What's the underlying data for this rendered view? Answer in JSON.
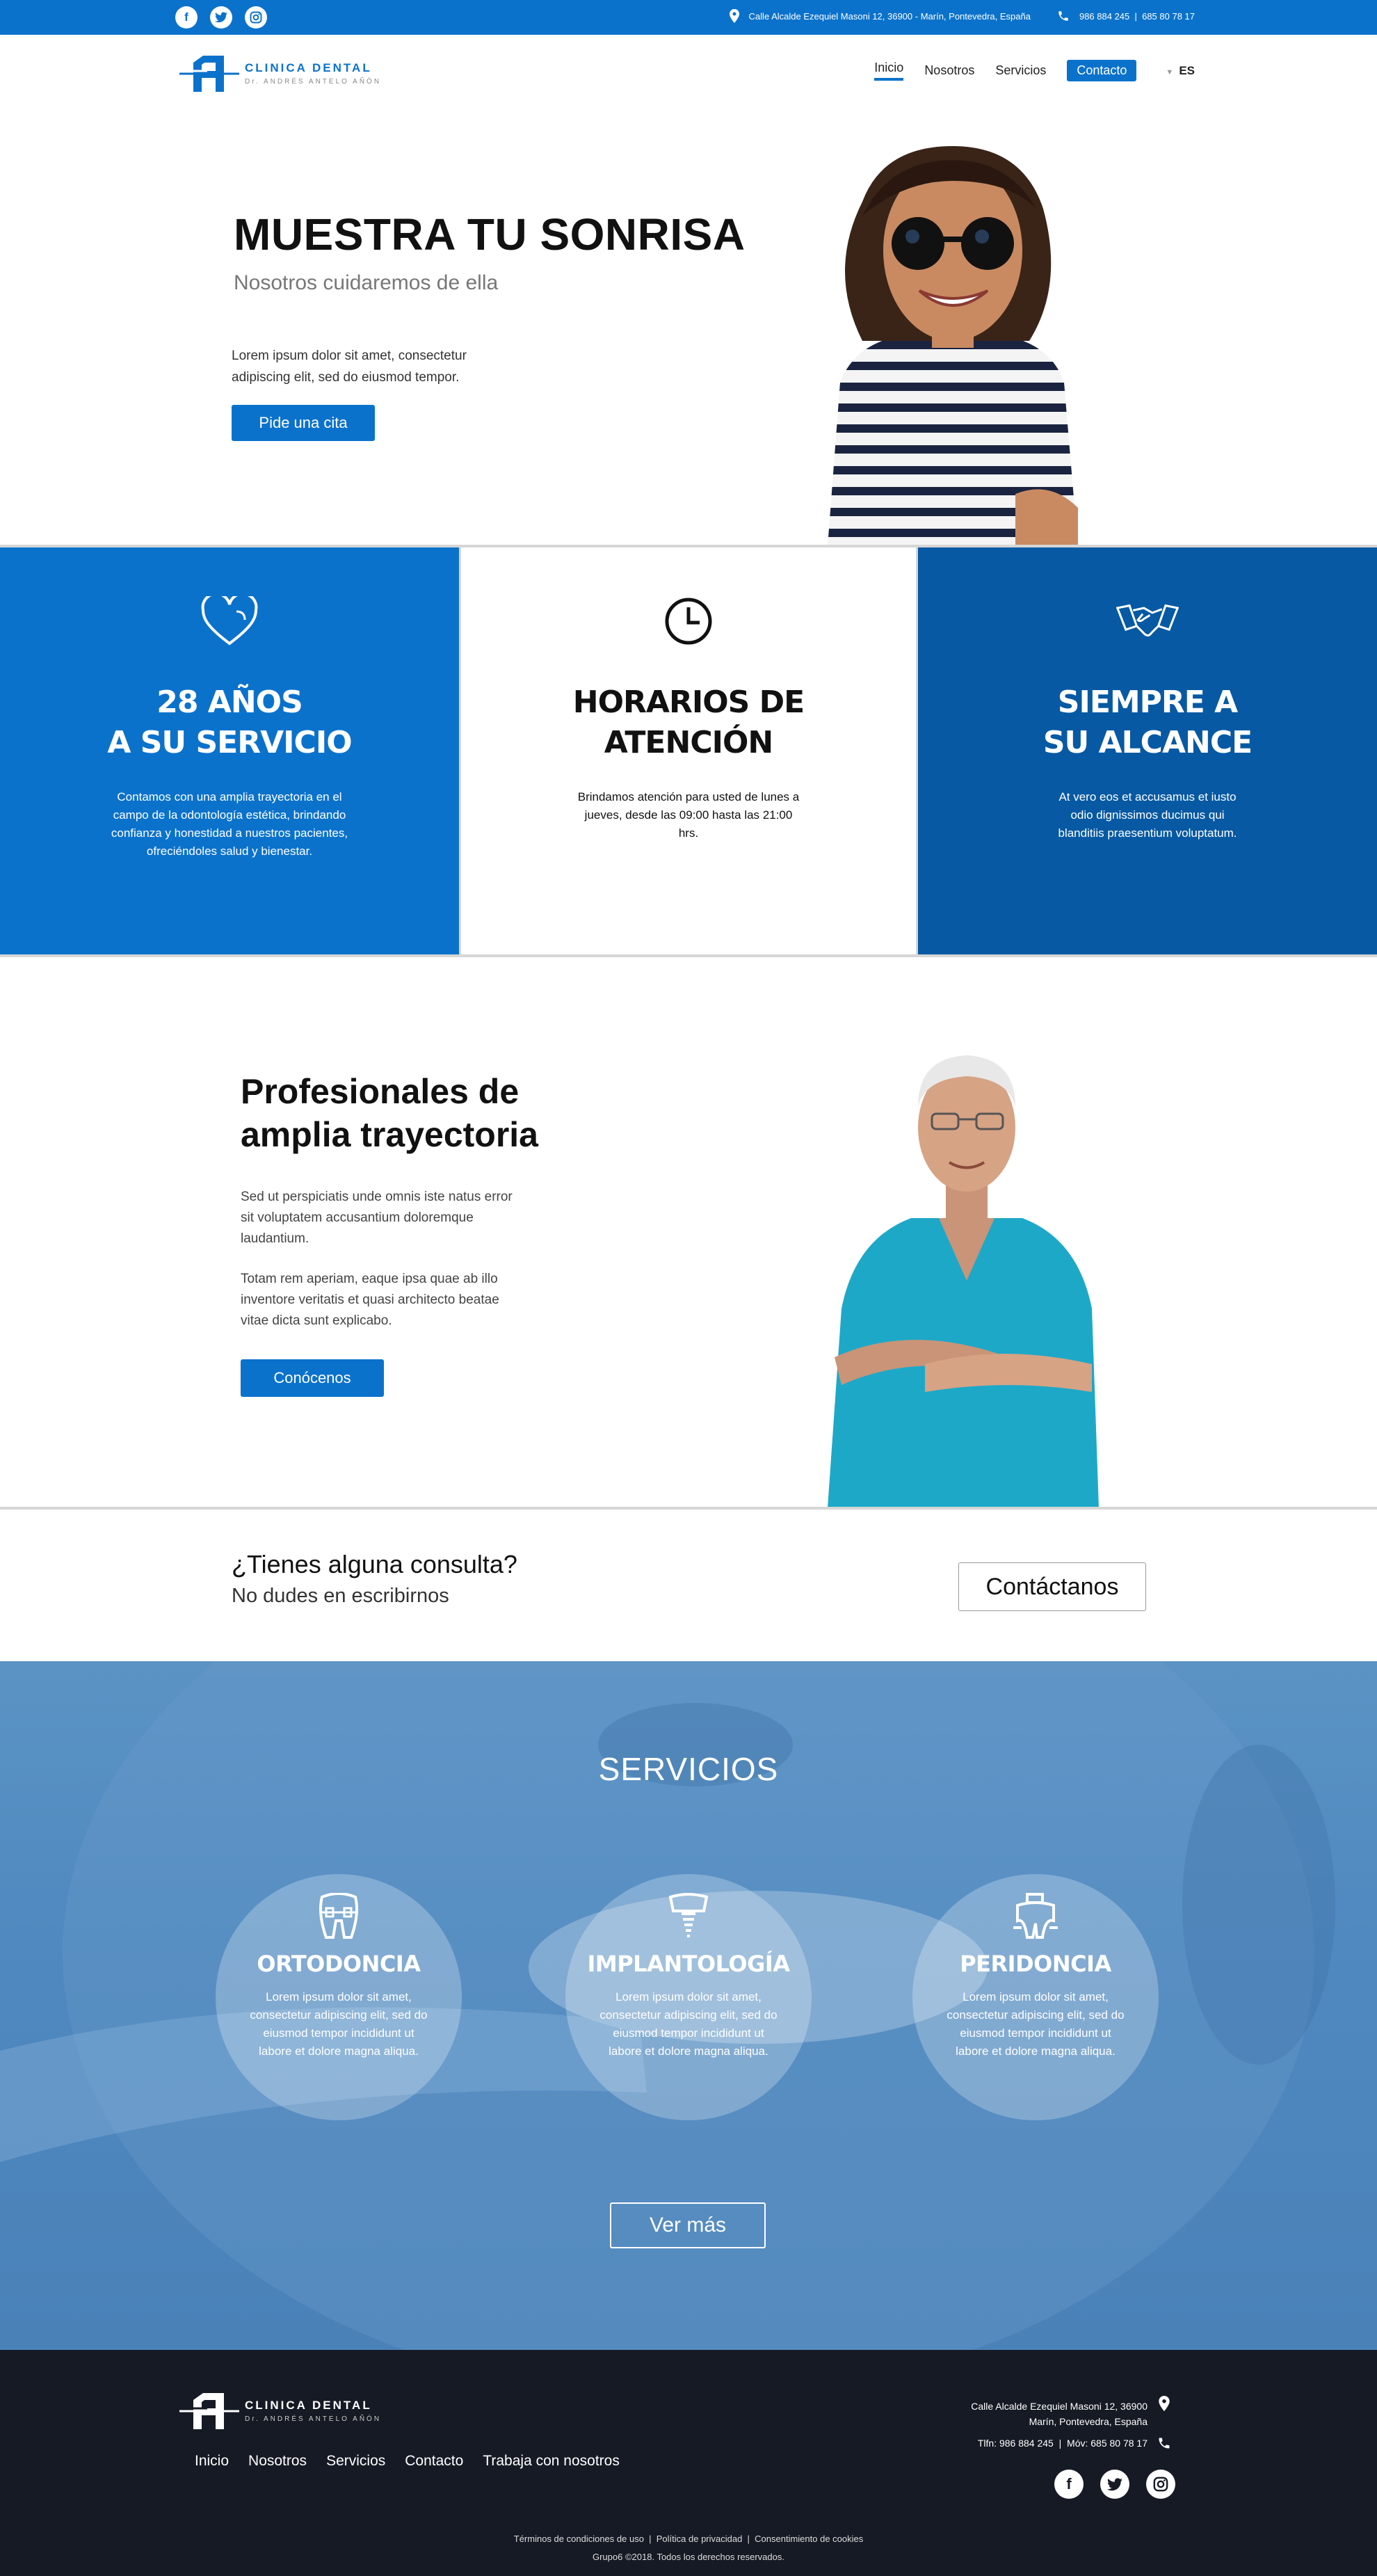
{
  "topbar": {
    "address": "Calle Alcalde Ezequiel Masoni 12, 36900 - Marín, Pontevedra, España",
    "phones": "986 884 245  |  685 80 78 17",
    "social": [
      "facebook-icon",
      "twitter-icon",
      "instagram-icon"
    ]
  },
  "header": {
    "logo_line1": "CLINICA DENTAL",
    "logo_line2": "Dr. ANDRÉS ANTELO AÑÓN",
    "nav": [
      "Inicio",
      "Nosotros",
      "Servicios",
      "Contacto"
    ],
    "lang": "ES"
  },
  "hero": {
    "title": "MUESTRA TU SONRISA",
    "subtitle": "Nosotros cuidaremos de ella",
    "text": "Lorem ipsum dolor sit amet, consectetur adipiscing elit, sed do eiusmod tempor.",
    "button": "Pide una cita"
  },
  "features": [
    {
      "icon": "heart-icon",
      "title_1": "28 AÑOS",
      "title_2": "A SU SERVICIO",
      "text": "Contamos con una amplia trayectoria en el campo de la odontología estética, brindando confianza y honestidad a nuestros pacientes, ofreciéndoles salud y bienestar."
    },
    {
      "icon": "clock-icon",
      "title_1": "HORARIOS DE",
      "title_2": "ATENCIÓN",
      "text": "Brindamos atención para usted de lunes a jueves, desde las 09:00 hasta las 21:00 hrs."
    },
    {
      "icon": "handshake-icon",
      "title_1": "SIEMPRE A",
      "title_2": "SU ALCANCE",
      "text": "At vero eos et accusamus et iusto odio dignissimos ducimus qui blanditiis praesentium voluptatum."
    }
  ],
  "pros": {
    "title_1": "Profesionales de",
    "title_2": "amplia trayectoria",
    "para_1": "Sed ut perspiciatis unde omnis iste natus error sit voluptatem accusantium doloremque laudantium.",
    "para_2": "Totam rem aperiam, eaque ipsa quae ab illo inventore veritatis et quasi architecto beatae vitae dicta sunt explicabo.",
    "button": "Conócenos"
  },
  "consulta": {
    "question": "¿Tienes alguna consulta?",
    "sub": "No dudes en escribirnos",
    "button": "Contáctanos"
  },
  "servicios": {
    "title": "SERVICIOS",
    "items": [
      {
        "icon": "braces-tooth-icon",
        "name": "ORTODONCIA",
        "text": "Lorem ipsum dolor sit amet, consectetur adipiscing elit, sed do eiusmod tempor incididunt ut labore et dolore magna aliqua."
      },
      {
        "icon": "implant-tooth-icon",
        "name": "IMPLANTOLOGÍA",
        "text": "Lorem ipsum dolor sit amet, consectetur adipiscing elit, sed do eiusmod tempor incididunt ut labore et dolore magna aliqua."
      },
      {
        "icon": "periodontics-tooth-icon",
        "name": "PERIDONCIA",
        "text": "Lorem ipsum dolor sit amet, consectetur adipiscing elit, sed do eiusmod tempor incididunt ut labore et dolore magna aliqua."
      }
    ],
    "button": "Ver más"
  },
  "footer": {
    "nav": [
      "Inicio",
      "Nosotros",
      "Servicios",
      "Contacto",
      "Trabaja con nosotros"
    ],
    "address_1": "Calle Alcalde Ezequiel Masoni 12, 36900",
    "address_2": "Marín, Pontevedra, España",
    "phones": "Tlfn: 986 884 245  |  Móv: 685 80 78 17",
    "legal": "Términos de condiciones de uso  |  Política de privacidad  |  Consentimiento de cookies",
    "copyright": "Grupo6 ©2018. Todos los derechos reservados."
  },
  "colors": {
    "brand_blue": "#0b72cc",
    "dark_blue": "#0759a3",
    "footer_bg": "#151a24"
  }
}
